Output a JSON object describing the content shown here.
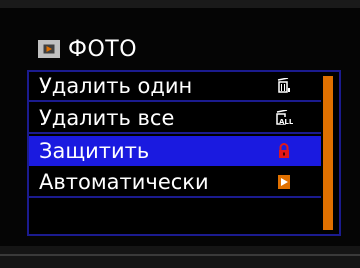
{
  "header": {
    "title": "ФОТО",
    "icon": "playback-icon"
  },
  "menu": {
    "items": [
      {
        "label": "Удалить один",
        "icon": "delete-one-icon",
        "selected": false
      },
      {
        "label": "Удалить все",
        "icon": "delete-all-icon",
        "selected": false
      },
      {
        "label": "Защитить",
        "icon": "lock-icon",
        "selected": true
      },
      {
        "label": "Автоматически",
        "icon": "slideshow-icon",
        "selected": false
      }
    ]
  },
  "colors": {
    "selection": "#1a1ae0",
    "border": "#1b1b8f",
    "scrollbar": "#e07000",
    "accent_red": "#e01818",
    "accent_orange": "#e07000"
  }
}
